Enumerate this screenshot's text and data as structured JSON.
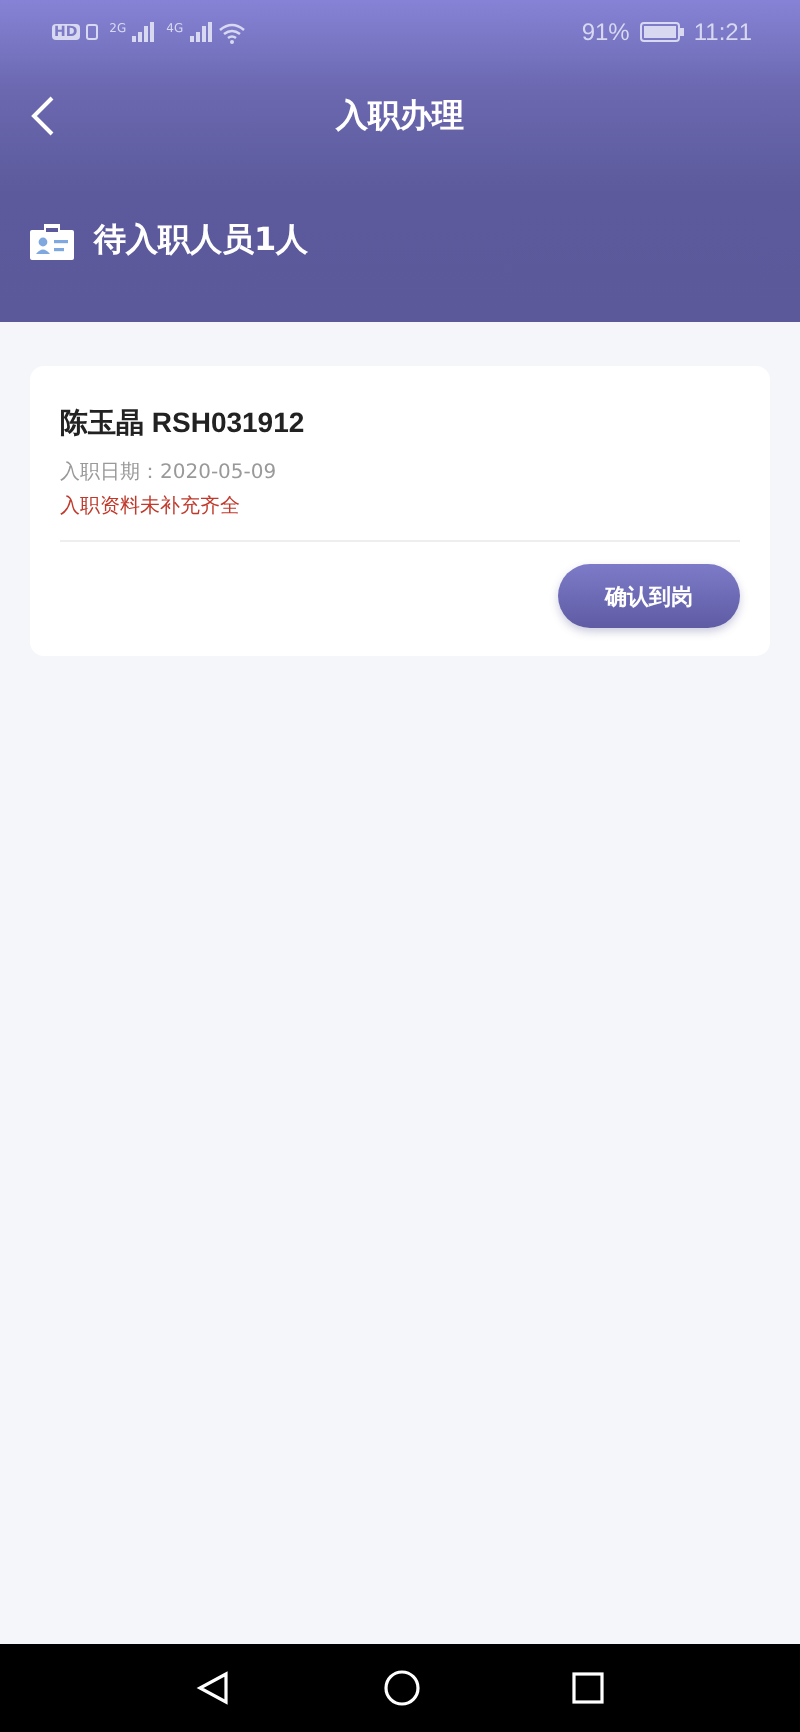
{
  "status_bar": {
    "hd": "HD",
    "networks": [
      "2G",
      "4G"
    ],
    "battery": "91%",
    "time": "11:21"
  },
  "header": {
    "title": "入职办理"
  },
  "banner": {
    "title": "待入职人员1人"
  },
  "employees": [
    {
      "name": "陈玉晶 RSH031912",
      "date": "入职日期：2020-05-09",
      "warning": "入职资料未补充齐全",
      "action": "确认到岗"
    }
  ]
}
